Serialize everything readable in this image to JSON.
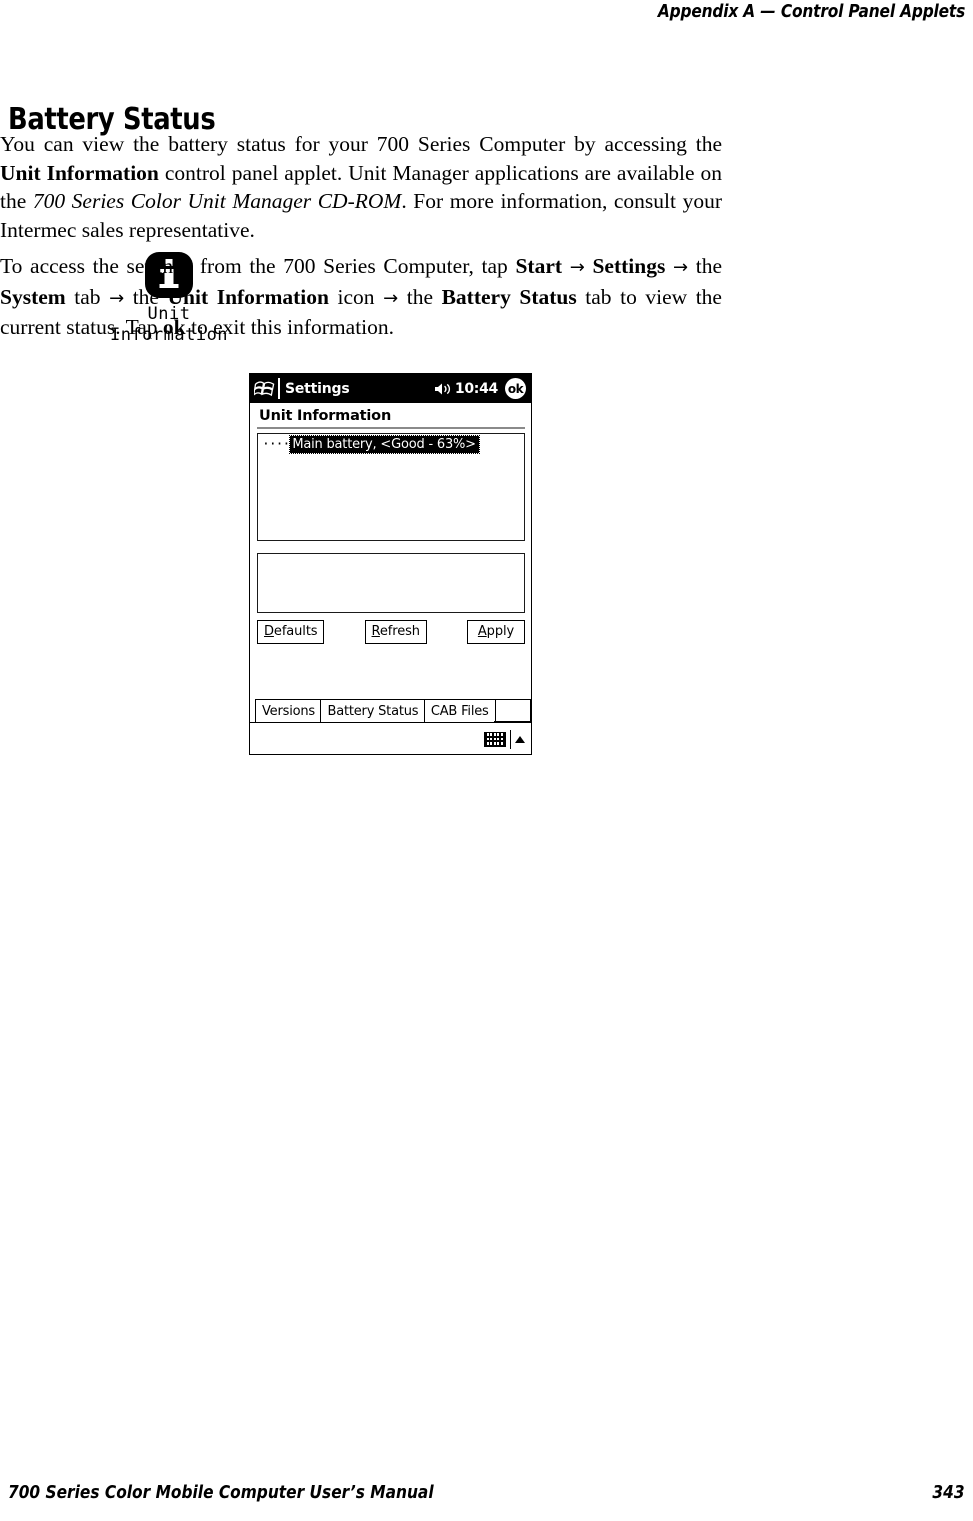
{
  "running_head": {
    "left": "Appendix A",
    "separator": "—",
    "right": "Control Panel Applets"
  },
  "section": {
    "title": "Battery Status"
  },
  "paragraphs": {
    "p1": {
      "s1": "You can view the battery status for your 700 Series Computer by accessing the ",
      "b1": "Unit Information",
      "s2": " control panel applet. Unit Manager applications are available on the ",
      "i1": "700 Series Color Unit Manager CD-ROM",
      "s3": ". For more information, consult your Intermec sales representative."
    },
    "p2": {
      "s1": "To access the settings from the 700 Series Computer, tap ",
      "b1": "Start",
      "a1": "→",
      "b2": "Settings",
      "a2": "→",
      "s2": " the ",
      "b3": "System",
      "s3": " tab ",
      "a3": "→",
      "s4": " the ",
      "b4": "Unit Information",
      "s5": " icon ",
      "a4": "→",
      "s6": " the ",
      "b5": "Battery Status",
      "s7": " tab to view the current status. Tap ",
      "b6": "ok",
      "s8": " to exit this information."
    }
  },
  "margin_icon": {
    "glyph_name": "information-i-icon",
    "caption_line1": "Unit",
    "caption_line2": "Information"
  },
  "pda": {
    "titlebar": {
      "logo_name": "windows-flag-icon",
      "title": "Settings",
      "speaker_name": "speaker-volume-icon",
      "clock": "10:44",
      "ok_label": "ok"
    },
    "heading": "Unit Information",
    "tree": {
      "prefix": "····",
      "selected_item": "Main battery, <Good - 63%>"
    },
    "detail_box_value": "",
    "buttons": [
      {
        "accel": "D",
        "rest": "efaults",
        "full": "Defaults"
      },
      {
        "accel": "R",
        "rest": "efresh",
        "full": "Refresh"
      },
      {
        "accel": "A",
        "rest": "pply",
        "full": "Apply"
      }
    ],
    "tabs": [
      {
        "label": "Versions",
        "selected": false
      },
      {
        "label": "Battery Status",
        "selected": true
      },
      {
        "label": "CAB Files",
        "selected": false
      }
    ],
    "sip": {
      "keyboard_name": "keyboard-sip-icon",
      "arrow_name": "chevron-up-icon"
    }
  },
  "footer": {
    "left": "700 Series Color Mobile Computer User’s Manual",
    "page": "343"
  },
  "colors": {
    "ink": "#000000",
    "paper": "#ffffff",
    "rule_gray": "#8a8a8a"
  }
}
